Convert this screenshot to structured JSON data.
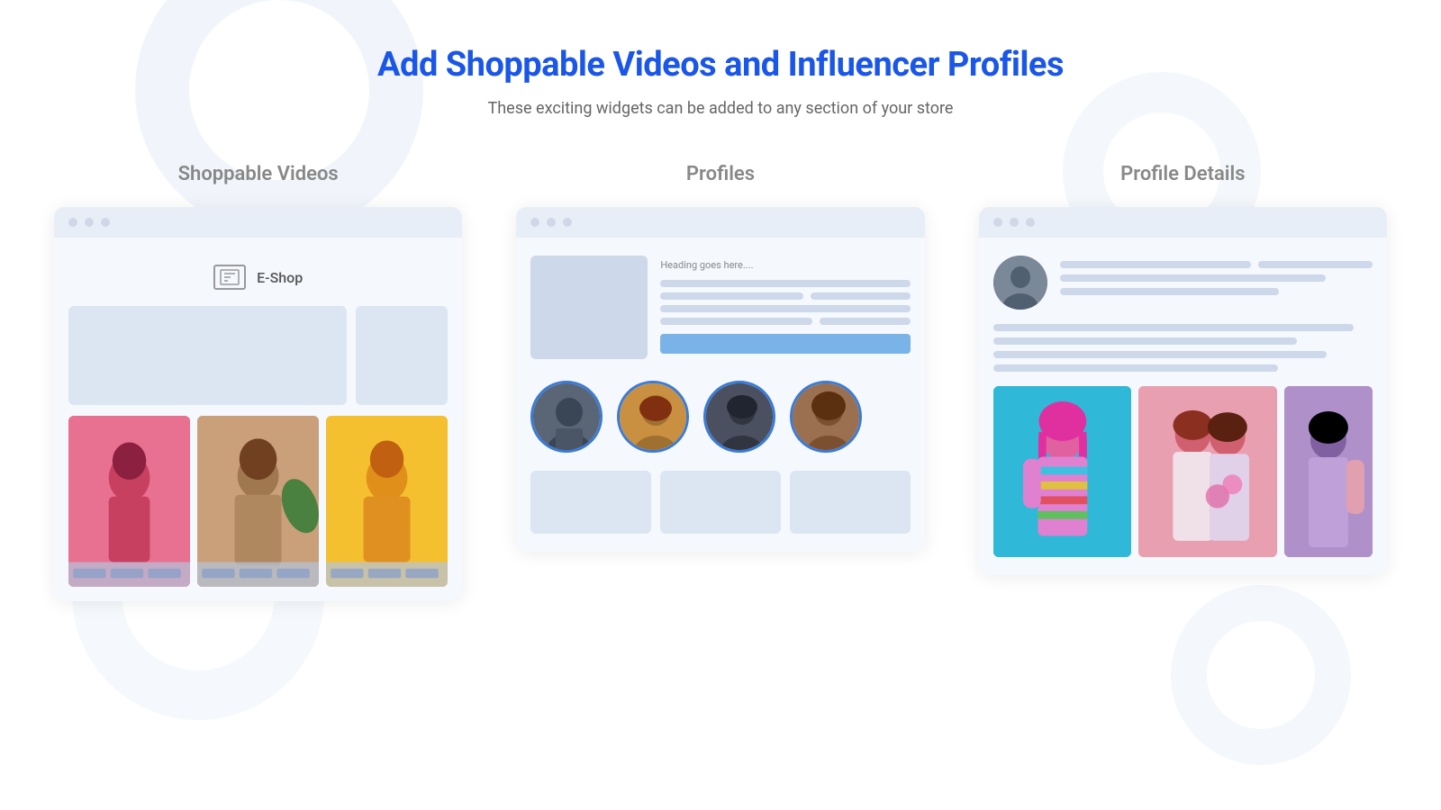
{
  "header": {
    "main_title": "Add Shoppable Videos and Influencer Profiles",
    "subtitle": "These exciting widgets can be added to any section of your store"
  },
  "sections": [
    {
      "id": "shoppable-videos",
      "label": "Shoppable Videos",
      "store_name": "E-Shop"
    },
    {
      "id": "profiles",
      "label": "Profiles",
      "heading_placeholder": "Heading goes here...."
    },
    {
      "id": "profile-details",
      "label": "Profile Details"
    }
  ],
  "browser_dots": [
    "dot1",
    "dot2",
    "dot3"
  ],
  "colors": {
    "title_blue": "#1a56e8",
    "label_gray": "#888888",
    "avatar_border": "#3a7bd5",
    "placeholder_bg": "#dce6f2",
    "button_blue": "#7ab3e8"
  }
}
